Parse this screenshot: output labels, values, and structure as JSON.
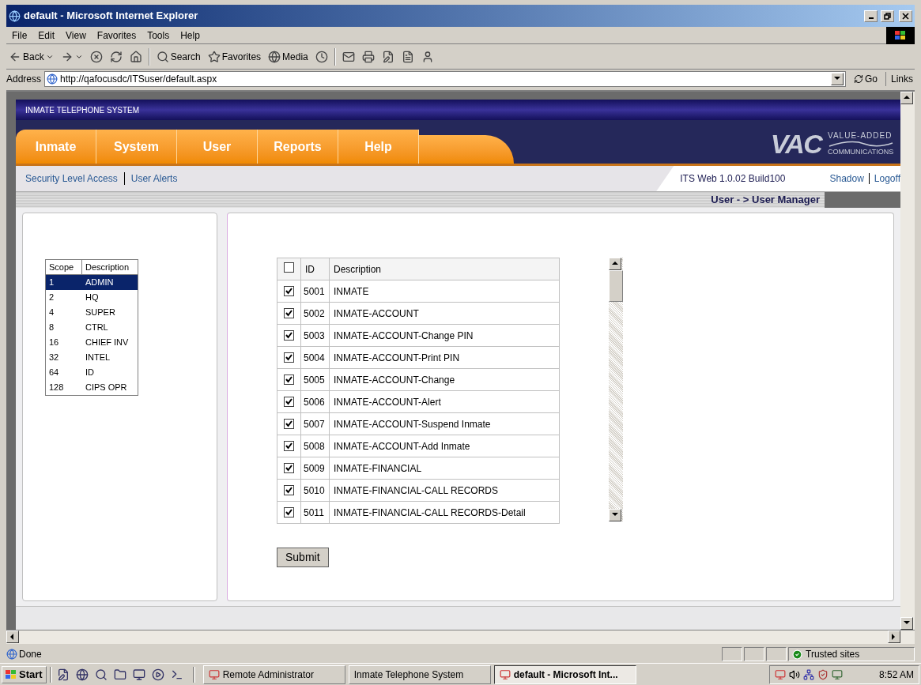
{
  "window": {
    "title": "default - Microsoft Internet Explorer"
  },
  "menu": [
    "File",
    "Edit",
    "View",
    "Favorites",
    "Tools",
    "Help"
  ],
  "toolbar": [
    {
      "kind": "back",
      "label": "Back"
    },
    {
      "kind": "forward"
    },
    {
      "kind": "stop"
    },
    {
      "kind": "refresh"
    },
    {
      "kind": "home"
    },
    {
      "kind": "search",
      "label": "Search"
    },
    {
      "kind": "favorites",
      "label": "Favorites"
    },
    {
      "kind": "media",
      "label": "Media"
    },
    {
      "kind": "history"
    },
    {
      "kind": "mail"
    },
    {
      "kind": "print"
    },
    {
      "kind": "edit"
    },
    {
      "kind": "discuss"
    },
    {
      "kind": "messenger"
    }
  ],
  "address": {
    "label": "Address",
    "url": "http://qafocusdc/ITSuser/default.aspx",
    "go": "Go",
    "links": "Links"
  },
  "app": {
    "title": "INMATE TELEPHONE SYSTEM",
    "nav": [
      "Inmate",
      "System",
      "User",
      "Reports",
      "Help"
    ],
    "logo": {
      "mark": "VAC",
      "line1": "VALUE-ADDED",
      "line2": "COMMUNICATIONS"
    },
    "subnav": [
      "Security Level Access",
      "User Alerts"
    ],
    "version": "ITS Web 1.0.02 Build100",
    "shadow": "Shadow",
    "logoff": "Logoff",
    "breadcrumb": "User - > User Manager"
  },
  "scope_table": {
    "columns": [
      "Scope",
      "Description"
    ],
    "rows": [
      {
        "scope": "1",
        "description": "ADMIN",
        "selected": true
      },
      {
        "scope": "2",
        "description": "HQ",
        "selected": false
      },
      {
        "scope": "4",
        "description": "SUPER",
        "selected": false
      },
      {
        "scope": "8",
        "description": "CTRL",
        "selected": false
      },
      {
        "scope": "16",
        "description": "CHIEF INV",
        "selected": false
      },
      {
        "scope": "32",
        "description": "INTEL",
        "selected": false
      },
      {
        "scope": "64",
        "description": "ID",
        "selected": false
      },
      {
        "scope": "128",
        "description": "CIPS OPR",
        "selected": false
      }
    ]
  },
  "permissions": {
    "header_checked": false,
    "columns": [
      "ID",
      "Description"
    ],
    "rows": [
      {
        "id": "5001",
        "description": "INMATE",
        "checked": true
      },
      {
        "id": "5002",
        "description": "INMATE-ACCOUNT",
        "checked": true
      },
      {
        "id": "5003",
        "description": "INMATE-ACCOUNT-Change PIN",
        "checked": true
      },
      {
        "id": "5004",
        "description": "INMATE-ACCOUNT-Print PIN",
        "checked": true
      },
      {
        "id": "5005",
        "description": "INMATE-ACCOUNT-Change",
        "checked": true
      },
      {
        "id": "5006",
        "description": "INMATE-ACCOUNT-Alert",
        "checked": true
      },
      {
        "id": "5007",
        "description": "INMATE-ACCOUNT-Suspend Inmate",
        "checked": true
      },
      {
        "id": "5008",
        "description": "INMATE-ACCOUNT-Add Inmate",
        "checked": true
      },
      {
        "id": "5009",
        "description": "INMATE-FINANCIAL",
        "checked": true
      },
      {
        "id": "5010",
        "description": "INMATE-FINANCIAL-CALL RECORDS",
        "checked": true
      },
      {
        "id": "5011",
        "description": "INMATE-FINANCIAL-CALL RECORDS-Detail",
        "checked": true
      }
    ],
    "submit": "Submit"
  },
  "status_bar": {
    "text": "Done",
    "zone": "Trusted sites"
  },
  "taskbar": {
    "start": "Start",
    "tasks": [
      {
        "label": "Remote Administrator",
        "selected": false
      },
      {
        "label": "Inmate Telephone System",
        "selected": false
      },
      {
        "label": "default - Microsoft Int...",
        "selected": true
      }
    ],
    "clock": "8:52 AM"
  }
}
